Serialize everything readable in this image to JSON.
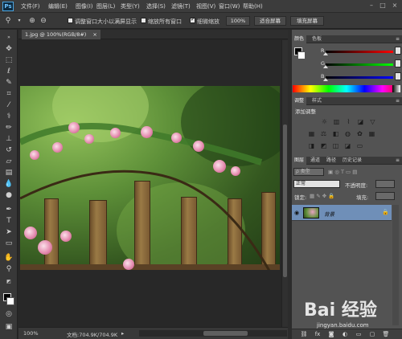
{
  "app": {
    "logo": "Ps"
  },
  "menubar": {
    "items": [
      "文件(F)",
      "编辑(E)",
      "图像(I)",
      "图层(L)",
      "类型(Y)",
      "选择(S)",
      "滤镜(T)",
      "视图(V)",
      "窗口(W)",
      "帮助(H)"
    ],
    "window_buttons": [
      "–",
      "□",
      "×"
    ]
  },
  "options_bar": {
    "tool_icon": "zoom-icon",
    "checkbox1_label": "调整窗口大小以满屏显示",
    "checkbox2_label": "缩放所有窗口",
    "checkbox3_label": "细微缩放",
    "checkbox3_checked": true,
    "btn_100": "100%",
    "btn_fit": "适合屏幕",
    "btn_fill": "填充屏幕"
  },
  "document": {
    "tab_label": "1.jpg @ 100%(RGB/8#)",
    "tab_close": "×"
  },
  "status": {
    "zoom": "100%",
    "doc_info": "文档:704.9K/704.9K"
  },
  "panels": {
    "color": {
      "tabs": [
        "颜色",
        "色板"
      ],
      "labels": [
        "R",
        "G",
        "B"
      ]
    },
    "adjust": {
      "tabs": [
        "调整",
        "样式"
      ],
      "title": "添加调整"
    },
    "layers": {
      "tabs": [
        "图层",
        "通道",
        "路径",
        "历史记录"
      ],
      "kind_label": "ρ 类型",
      "blend_mode": "正常",
      "opacity_label": "不透明度:",
      "lock_label": "锁定:",
      "fill_label": "填充:",
      "layer_name": "背景"
    }
  },
  "watermark": {
    "text": "Bai 经验",
    "sub": "jingyan.baidu.com"
  }
}
